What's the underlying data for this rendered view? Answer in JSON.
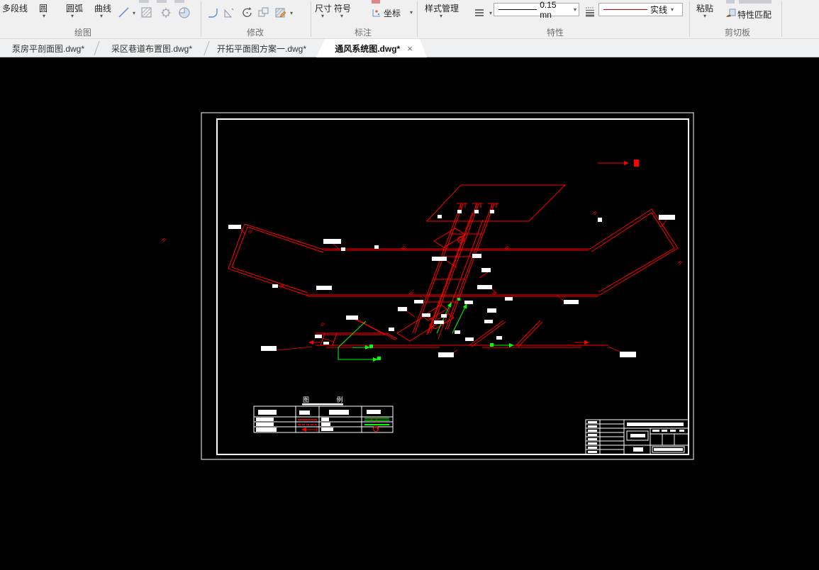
{
  "ribbon": {
    "groups": {
      "draw": {
        "label": "绘图",
        "buttons": [
          "多段线",
          "圆",
          "圆弧",
          "曲线"
        ]
      },
      "modify": {
        "label": "修改"
      },
      "annotate": {
        "label": "标注",
        "buttons": [
          "尺寸",
          "符号",
          "坐标"
        ]
      },
      "properties": {
        "label": "特性",
        "style_manager": "样式管理",
        "lineweight": "0.15 mn",
        "linetype": "实线"
      },
      "clipboard": {
        "label": "剪切板",
        "paste": "粘贴",
        "match": "特性匹配"
      }
    }
  },
  "tabs": {
    "items": [
      {
        "label": "泵房平剖面图.dwg*"
      },
      {
        "label": "采区巷道布置图.dwg*"
      },
      {
        "label": "开拓平面图方案一.dwg*"
      },
      {
        "label": "通风系统图.dwg*"
      }
    ],
    "close_glyph": "×"
  },
  "canvas": {
    "legend_title": "图 例",
    "colors": {
      "roadway_red": "#ff0000",
      "airflow_green": "#00ff00",
      "frame_white": "#ffffff",
      "background": "#000000"
    }
  }
}
